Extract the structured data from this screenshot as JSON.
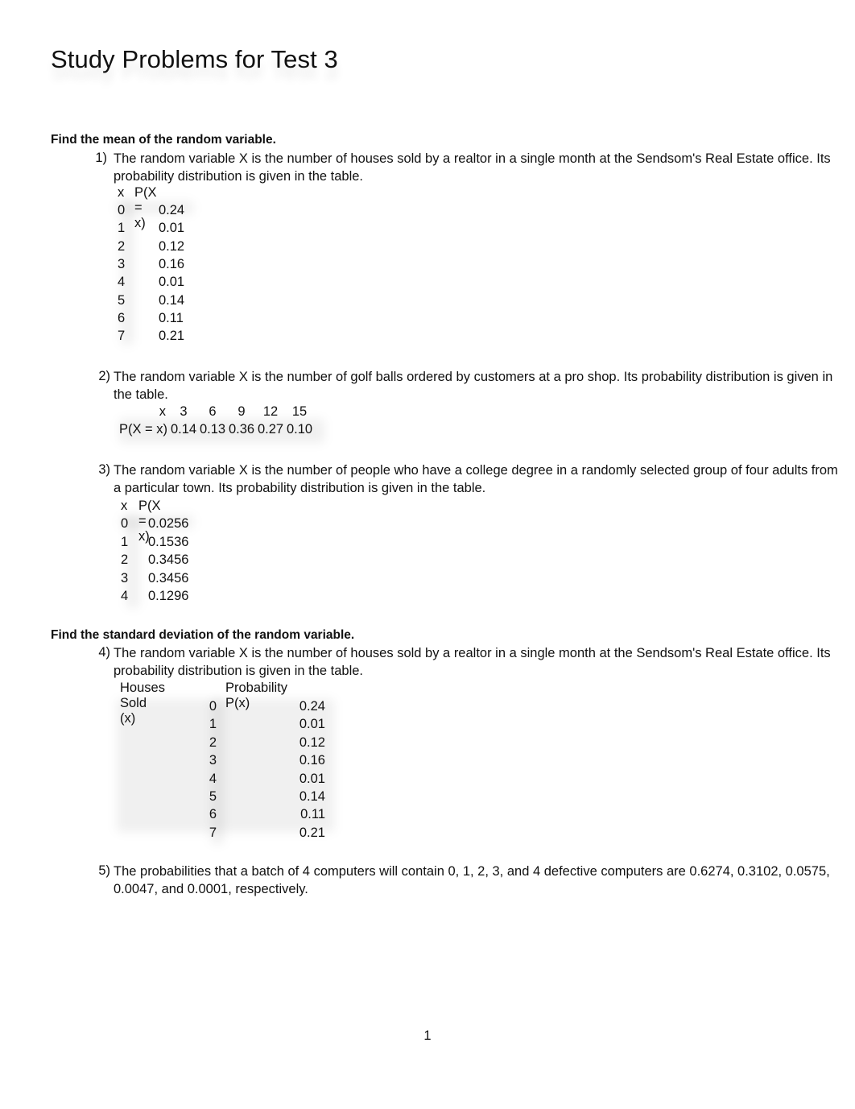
{
  "document": {
    "title": "Study Problems for Test 3",
    "page_number": "1"
  },
  "sections": [
    {
      "heading": "Find the mean of the random variable."
    },
    {
      "heading": "Find the standard deviation of the random variable."
    }
  ],
  "problems": [
    {
      "number": "1)",
      "text": "The random variable X is the number of houses sold by a realtor in a single month at the Sendsom's Real Estate office. Its probability distribution is given in the table.",
      "table": {
        "headers": [
          "x",
          "P(X = x)"
        ],
        "rows": [
          [
            "0",
            "0.24"
          ],
          [
            "1",
            "0.01"
          ],
          [
            "2",
            "0.12"
          ],
          [
            "3",
            "0.16"
          ],
          [
            "4",
            "0.01"
          ],
          [
            "5",
            "0.14"
          ],
          [
            "6",
            "0.11"
          ],
          [
            "7",
            "0.21"
          ]
        ]
      }
    },
    {
      "number": "2)",
      "text": "The random variable X is the number of golf balls ordered by customers at a pro shop. Its probability distribution is given in the table.",
      "table": {
        "row_labels": [
          "x",
          "P(X = x)"
        ],
        "x_values": [
          "3",
          "6",
          "9",
          "12",
          "15"
        ],
        "p_values": [
          "0.14",
          "0.13",
          "0.36",
          "0.27",
          "0.10"
        ]
      }
    },
    {
      "number": "3)",
      "text": "The random variable X is the number of people who have a college degree in a randomly selected group of four adults from a particular town. Its probability distribution is given in the table.",
      "table": {
        "headers": [
          "x",
          "P(X = x)"
        ],
        "rows": [
          [
            "0",
            "0.0256"
          ],
          [
            "1",
            "0.1536"
          ],
          [
            "2",
            "0.3456"
          ],
          [
            "3",
            "0.3456"
          ],
          [
            "4",
            "0.1296"
          ]
        ]
      }
    },
    {
      "number": "4)",
      "text": "The random variable X is the number of houses sold by a realtor in a single month at the Sendsom's Real Estate office. Its probability distribution is given in the table.",
      "table": {
        "headers": [
          "Houses Sold (x)",
          "Probability P(x)"
        ],
        "rows": [
          [
            "0",
            "0.24"
          ],
          [
            "1",
            "0.01"
          ],
          [
            "2",
            "0.12"
          ],
          [
            "3",
            "0.16"
          ],
          [
            "4",
            "0.01"
          ],
          [
            "5",
            "0.14"
          ],
          [
            "6",
            "0.11"
          ],
          [
            "7",
            "0.21"
          ]
        ]
      }
    },
    {
      "number": "5)",
      "text": "The probabilities that a batch of 4 computers will contain 0, 1, 2, 3, and 4 defective computers are 0.6274, 0.3102, 0.0575, 0.0047, and 0.0001, respectively."
    }
  ]
}
